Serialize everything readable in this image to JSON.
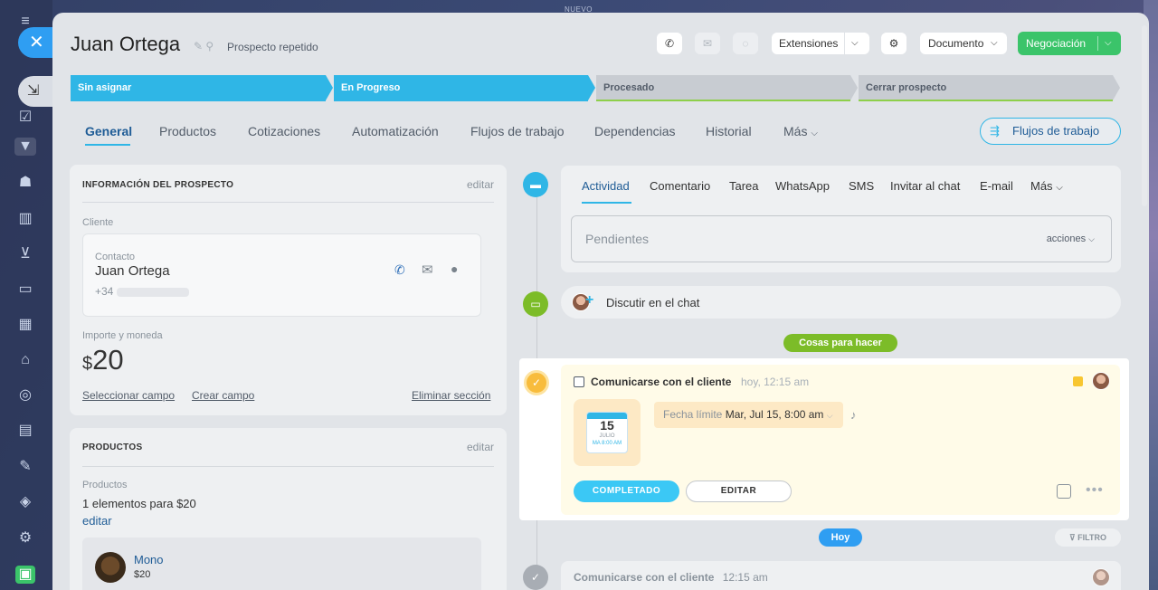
{
  "top_label": "NUEVO",
  "header": {
    "title": "Juan Ortega",
    "subtitle": "Prospecto repetido",
    "extensiones": "Extensiones",
    "documento": "Documento",
    "negociacion": "Negociación"
  },
  "stages": [
    {
      "label": "Sin asignar",
      "state": "active",
      "color": "#2fb6e6"
    },
    {
      "label": "En Progreso",
      "state": "active",
      "color": "#2fb6e6"
    },
    {
      "label": "Procesado",
      "state": "pending",
      "color": "#c8ccd2"
    },
    {
      "label": "Cerrar prospecto",
      "state": "pending",
      "color": "#c8ccd2"
    }
  ],
  "tabs": [
    "General",
    "Productos",
    "Cotizaciones",
    "Automatización",
    "Flujos de trabajo",
    "Dependencias",
    "Historial",
    "Más"
  ],
  "flujos_button": "Flujos de trabajo",
  "info_card": {
    "title": "INFORMACIÓN DEL PROSPECTO",
    "edit": "editar",
    "client_label": "Cliente",
    "contact_label": "Contacto",
    "contact_name": "Juan Ortega",
    "phone": "+34",
    "amount_label": "Importe y moneda",
    "currency": "$",
    "amount": "20",
    "select_field": "Seleccionar campo",
    "create_field": "Crear campo",
    "delete_section": "Eliminar sección"
  },
  "products_card": {
    "title": "PRODUCTOS",
    "edit": "editar",
    "label": "Productos",
    "summary": "1 elementos para $20",
    "edit_link": "editar",
    "item_name": "Mono",
    "item_price": "$20"
  },
  "activity": {
    "tabs": [
      "Actividad",
      "Comentario",
      "Tarea",
      "WhatsApp",
      "SMS",
      "Invitar al chat",
      "E-mail",
      "Más"
    ],
    "pending_placeholder": "Pendientes",
    "actions": "acciones"
  },
  "chat_row": "Discutir en el chat",
  "todo_pill": "Cosas para hacer",
  "todo": {
    "title": "Comunicarse con el cliente",
    "time": "hoy, 12:15 am",
    "cal_day": "15",
    "cal_month": "JULIO",
    "cal_sub": "MA 8:00 AM",
    "deadline_label": "Fecha límite",
    "deadline_value": "Mar, Jul 15, 8:00 am",
    "complete": "COMPLETADO",
    "edit": "EDITAR"
  },
  "today_pill": "Hoy",
  "filter": "FILTRO",
  "history_item": {
    "title": "Comunicarse con el cliente",
    "time": "12:15 am"
  },
  "colors": {
    "accent": "#2fb6e6",
    "green": "#3bc46a",
    "pill_green": "#7cbc28",
    "todo_bg": "#fffbe8"
  }
}
